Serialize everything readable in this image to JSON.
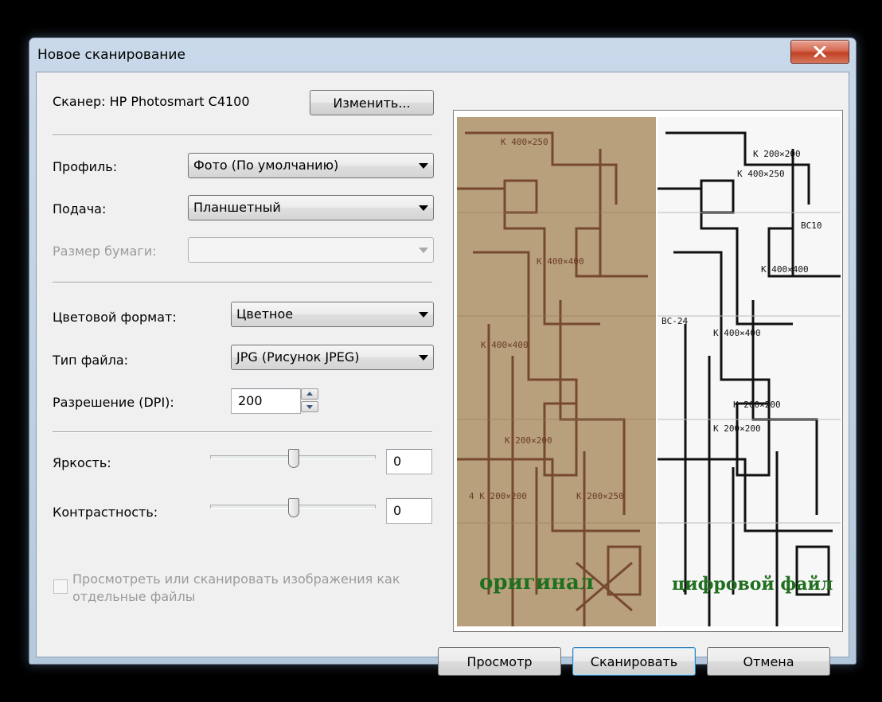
{
  "window": {
    "title": "Новое сканирование"
  },
  "scanner": {
    "label": "Сканер: HP Photosmart C4100",
    "change_button": "Изменить..."
  },
  "form": {
    "profile": {
      "label": "Профиль:",
      "value": "Фото (По умолчанию)"
    },
    "source": {
      "label": "Подача:",
      "value": "Планшетный"
    },
    "paper_size": {
      "label": "Размер бумаги:",
      "value": ""
    },
    "color_format": {
      "label": "Цветовой формат:",
      "value": "Цветное"
    },
    "file_type": {
      "label": "Тип файла:",
      "value": "JPG (Рисунок JPEG)"
    },
    "resolution": {
      "label": "Разрешение (DPI):",
      "value": "200"
    },
    "brightness": {
      "label": "Яркость:",
      "value": "0"
    },
    "contrast": {
      "label": "Контрастность:",
      "value": "0"
    },
    "separate_files": {
      "label_line1": "Просмотреть или сканировать изображения как",
      "label_line2": "отдельные файлы",
      "checked": false
    }
  },
  "preview": {
    "caption_original": "оригинал",
    "caption_digital": "цифровой файл"
  },
  "buttons": {
    "preview": "Просмотр",
    "scan": "Сканировать",
    "cancel": "Отмена"
  },
  "colors": {
    "caption_green": "#1f6f1f",
    "close_red": "#c13f24",
    "default_button_border": "#3c7fb1"
  }
}
